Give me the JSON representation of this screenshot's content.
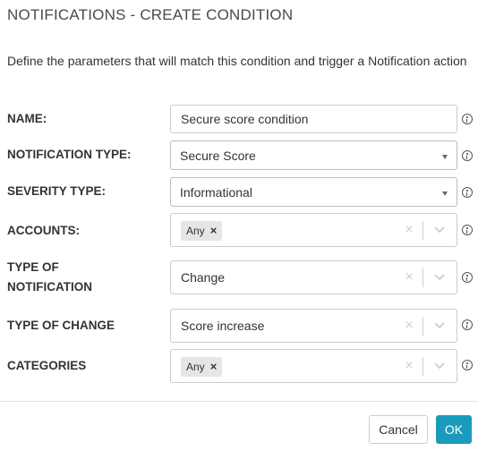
{
  "dialog": {
    "title": "NOTIFICATIONS - CREATE CONDITION",
    "description": "Define the parameters that will match this condition and trigger a Notification action"
  },
  "fields": {
    "name": {
      "label": "NAME:",
      "value": "Secure score condition"
    },
    "notification_type": {
      "label": "NOTIFICATION TYPE:",
      "value": "Secure Score"
    },
    "severity_type": {
      "label": "SEVERITY TYPE:",
      "value": "Informational"
    },
    "accounts": {
      "label": "ACCOUNTS:",
      "tag": "Any",
      "tag_remove": "×",
      "clear": "×"
    },
    "type_of_notification": {
      "label_line1": "TYPE OF",
      "label_line2": "NOTIFICATION",
      "value": "Change",
      "clear": "×"
    },
    "type_of_change": {
      "label": "TYPE OF CHANGE",
      "value": "Score increase",
      "clear": "×"
    },
    "categories": {
      "label": "CATEGORIES",
      "tag": "Any",
      "tag_remove": "×",
      "clear": "×"
    }
  },
  "footer": {
    "cancel_label": "Cancel",
    "ok_label": "OK"
  },
  "colors": {
    "primary": "#1a9bbd",
    "border": "#cccccc",
    "tag_bg": "#e6e6e6"
  },
  "icons": {
    "info": "info-icon",
    "clear": "clear-icon",
    "chevron": "chevron-down-icon",
    "caret": "caret-down-icon"
  }
}
